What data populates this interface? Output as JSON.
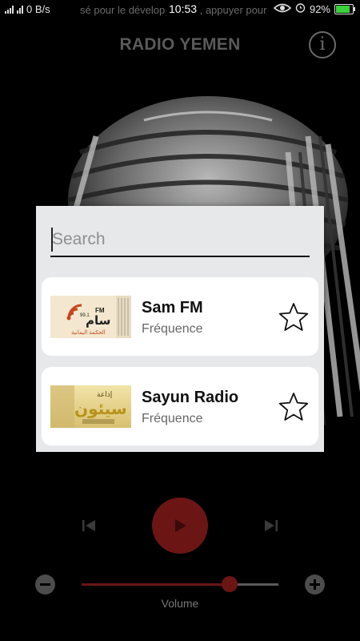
{
  "status_bar": {
    "network_speed": "0 B/s",
    "ticker": "sé pour le développement, appuyer pour",
    "time": "10:53",
    "battery_percent": "92%",
    "battery_level": 0.92
  },
  "header": {
    "title": "RADIO YEMEN",
    "info_label": "i"
  },
  "search": {
    "placeholder": "Search",
    "value": ""
  },
  "stations": [
    {
      "name": "Sam FM",
      "subtitle": "Fréquence",
      "logo_text_top": "FM",
      "logo_text_freq": "99.1",
      "logo_text_main": "سام",
      "logo_text_bottom": "الحكمة اليمانية",
      "favorite": false
    },
    {
      "name": "Sayun Radio",
      "subtitle": "Fréquence",
      "logo_text_top": "إذاعة",
      "logo_text_main": "سيئون",
      "favorite": false
    }
  ],
  "player": {
    "volume_label": "Volume",
    "volume_level": 0.75,
    "accent_color": "#6b1515"
  }
}
